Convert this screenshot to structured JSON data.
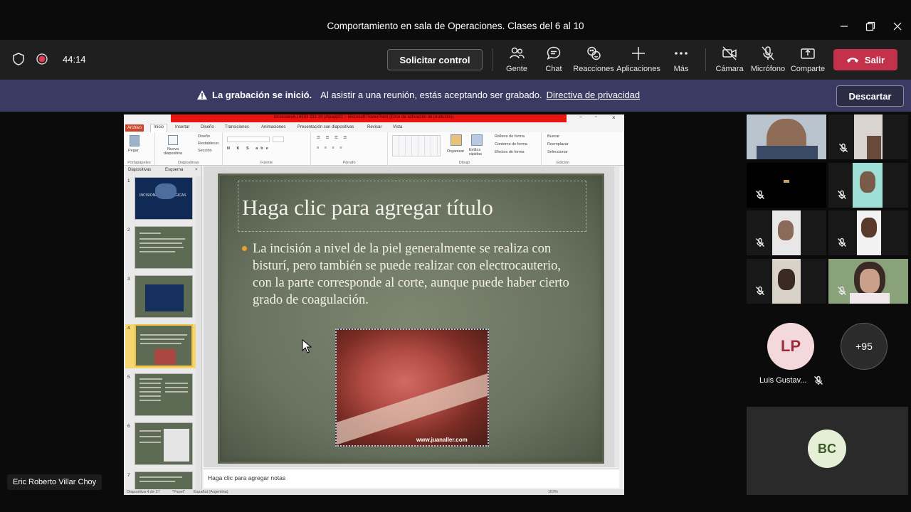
{
  "window": {
    "title": "Comportamiento en sala de Operaciones. Clases del 6 al 10"
  },
  "toolbar": {
    "timer": "44:14",
    "request_control": "Solicitar control",
    "items": [
      {
        "label": "Gente",
        "icon": "people-icon"
      },
      {
        "label": "Chat",
        "icon": "chat-icon"
      },
      {
        "label": "Reacciones",
        "icon": "reactions-icon"
      },
      {
        "label": "Aplicaciones",
        "icon": "plus-icon"
      },
      {
        "label": "Más",
        "icon": "more-icon"
      },
      {
        "label": "Cámara",
        "icon": "camera-off-icon"
      },
      {
        "label": "Micrófono",
        "icon": "mic-off-icon"
      },
      {
        "label": "Comparte",
        "icon": "share-icon"
      }
    ],
    "leave": "Salir",
    "leave_color": "#c4314b"
  },
  "banner": {
    "bold": "La grabación se inició.",
    "text": "Al asistir a una reunión, estás aceptando ser grabado.",
    "link": "Directiva de privacidad",
    "dismiss": "Descartar",
    "background": "#3b3a63"
  },
  "ppt": {
    "window_title": "incisiones6-14503 231 34-phpapp01 – Microsoft PowerPoint (Error de activación de productos)",
    "file_tab": "Archivo",
    "tabs": [
      "Inicio",
      "Insertar",
      "Diseño",
      "Transiciones",
      "Animaciones",
      "Presentación con diapositivas",
      "Revisar",
      "Vista"
    ],
    "ribbon": {
      "paste": "Pegar",
      "new_slide": "Nueva diapositiva",
      "layout": "Diseño",
      "reset": "Restablecer",
      "section": "Sección",
      "arrange": "Organizar",
      "quick_styles": "Estilos rápidos",
      "shape_fill": "Relleno de forma",
      "shape_outline": "Contorno de forma",
      "shape_effects": "Efectos de forma",
      "find": "Buscar",
      "replace": "Reemplazar",
      "select": "Seleccionar",
      "groups": [
        "Portapapeles",
        "Diapositivas",
        "Fuente",
        "Párrafo",
        "Dibujo",
        "Edición"
      ]
    },
    "panel_tabs": [
      "Diapositivas",
      "Esquema"
    ],
    "thumbnails": [
      "1",
      "2",
      "3",
      "4",
      "5",
      "6",
      "7"
    ],
    "thumb1_title": "INCISIONES QUIRÚRGICAS",
    "slide": {
      "title": "Haga clic para agregar título",
      "body": "La incisión a nivel de la piel generalmente se realiza con bisturí, pero también se puede realizar con electrocauterio, con la parte corresponde al corte, aunque puede haber cierto grado de coagulación.",
      "watermark": "www.juanaller.com"
    },
    "notes_placeholder": "Haga clic para agregar notas",
    "status": {
      "slide_count": "Diapositiva 4 de 27",
      "theme": "\"Papel\"",
      "language": "Español (Argentina)",
      "zoom": "103%"
    }
  },
  "presenter": {
    "name": "Eric Roberto Villar Choy"
  },
  "participants": {
    "lp_initials": "LP",
    "lp_name": "Luis Gustav...",
    "lp_color": "#f4d9dc",
    "more": "+95",
    "bc_initials": "BC",
    "bc_color": "#e5efd6"
  }
}
